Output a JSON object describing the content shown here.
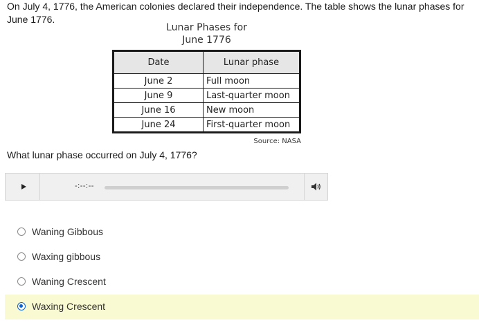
{
  "question": {
    "intro": "On July 4, 1776, the American colonies declared their independence.  The table shows the lunar phases for June 1776.",
    "prompt": "What lunar phase occurred on July 4, 1776?"
  },
  "table": {
    "title_line1": "Lunar Phases for",
    "title_line2": "June 1776",
    "headers": [
      "Date",
      "Lunar phase"
    ],
    "rows": [
      [
        "June 2",
        "Full moon"
      ],
      [
        "June 9",
        "Last-quarter moon"
      ],
      [
        "June 16",
        "New moon"
      ],
      [
        "June 24",
        "First-quarter moon"
      ]
    ],
    "source": "Source: NASA"
  },
  "audio_player": {
    "time": "-:--:--",
    "progress": 0,
    "play_icon": "play-icon",
    "volume_icon": "volume-icon"
  },
  "answers": {
    "options": [
      "Waning Gibbous",
      "Waxing gibbous",
      "Waning Crescent",
      "Waxing Crescent"
    ],
    "selected_index": 3
  },
  "colors": {
    "selected_highlight": "#fafad2",
    "radio_selected": "#0a63d6",
    "table_header_bg": "#e6e6e6"
  }
}
